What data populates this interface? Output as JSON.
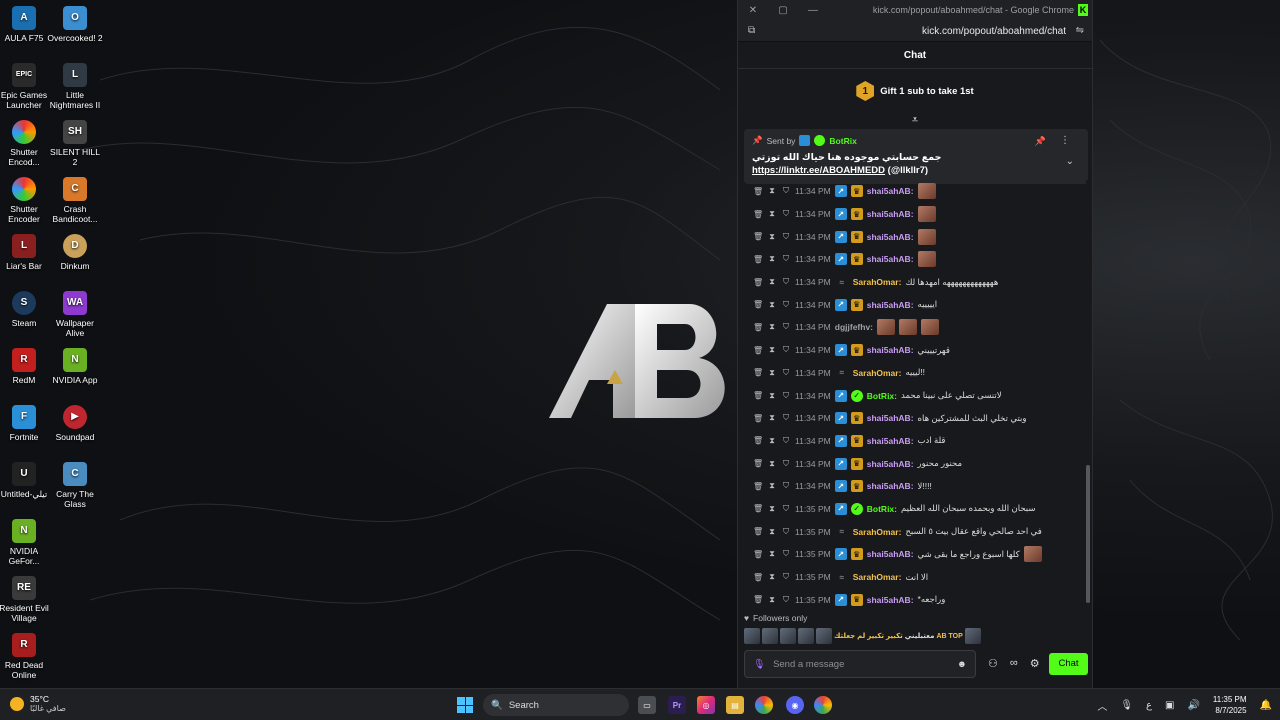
{
  "desktop": {
    "icons": [
      {
        "label": "AULA F75",
        "color": "#1a6fb0",
        "glyph": "A"
      },
      {
        "label": "Overcooked! 2",
        "color": "#3b8fd1",
        "glyph": "O"
      },
      {
        "label": "Epic Games Launcher",
        "color": "#2a2a2a",
        "glyph": "EPIC"
      },
      {
        "label": "Little Nightmares II",
        "color": "#303a44",
        "glyph": "L"
      },
      {
        "label": "Shutter Encod...",
        "color": "#d93b3b",
        "glyph": "S"
      },
      {
        "label": "SILENT HILL 2",
        "color": "#444",
        "glyph": "SH"
      },
      {
        "label": "Shutter Encoder",
        "color": "#d93b3b",
        "glyph": "S"
      },
      {
        "label": "Crash Bandicoot...",
        "color": "#d7782a",
        "glyph": "C"
      },
      {
        "label": "Liar's Bar",
        "color": "#8a1f1f",
        "glyph": "L"
      },
      {
        "label": "Dinkum",
        "color": "#c9a15a",
        "glyph": "D"
      },
      {
        "label": "Steam",
        "color": "#1b3a5c",
        "glyph": "S"
      },
      {
        "label": "Wallpaper Alive",
        "color": "#8e3ad1",
        "glyph": "WA"
      },
      {
        "label": "RedM",
        "color": "#c21f1f",
        "glyph": "R"
      },
      {
        "label": "NVIDIA App",
        "color": "#6ab023",
        "glyph": "N"
      },
      {
        "label": "Fortnite",
        "color": "#2a8fd6",
        "glyph": "F"
      },
      {
        "label": "Soundpad",
        "color": "#c0262f",
        "glyph": "▶"
      },
      {
        "label": "Untitled-تيلي",
        "color": "#222",
        "glyph": "U"
      },
      {
        "label": "Carry The Glass",
        "color": "#4a8cc0",
        "glyph": "C"
      },
      {
        "label": "NVIDIA GeFor...",
        "color": "#6ab023",
        "glyph": "N"
      },
      {
        "label": "Resident Evil Village",
        "color": "#3a3a3a",
        "glyph": "RE"
      },
      {
        "label": "Red Dead Online",
        "color": "#a81d1d",
        "glyph": "R"
      }
    ]
  },
  "window": {
    "title": "kick.com/popout/aboahmed/chat - Google Chrome",
    "url": "kick.com/popout/aboahmed/chat"
  },
  "chat": {
    "header": "Chat",
    "gift": {
      "rank": "1",
      "text": "Gift 1 sub to take 1st"
    },
    "pinned": {
      "sent_by": "Sent by",
      "bot": "BotRix",
      "message_text": "جمع حسابتي موجوده هنا حياك الله توزتي",
      "link": "https://linktr.ee/ABOAHMEDD",
      "handle": "(@llkllr7)"
    },
    "messages": [
      {
        "time": "11:34 PM",
        "user": "shai5ahAB:",
        "color": "#c99cf5",
        "badges": [
          "sub",
          "crown"
        ],
        "text": "",
        "emotes": 1
      },
      {
        "time": "11:34 PM",
        "user": "shai5ahAB:",
        "color": "#c99cf5",
        "badges": [
          "sub",
          "crown"
        ],
        "text": "",
        "emotes": 1
      },
      {
        "time": "11:34 PM",
        "user": "shai5ahAB:",
        "color": "#c99cf5",
        "badges": [
          "sub",
          "crown"
        ],
        "text": "",
        "emotes": 1
      },
      {
        "time": "11:34 PM",
        "user": "shai5ahAB:",
        "color": "#c99cf5",
        "badges": [
          "sub",
          "crown"
        ],
        "text": "",
        "emotes": 1
      },
      {
        "time": "11:34 PM",
        "user": "SarahOmar:",
        "color": "#f2c14e",
        "badges": [
          "wave"
        ],
        "text": "هههههههههههههه امهدها لك",
        "emotes": 0
      },
      {
        "time": "11:34 PM",
        "user": "shai5ahAB:",
        "color": "#c99cf5",
        "badges": [
          "sub",
          "crown"
        ],
        "text": "ايييييه",
        "emotes": 0
      },
      {
        "time": "11:34 PM",
        "user": "dgjjfefhv:",
        "color": "#a0a0a0",
        "badges": [],
        "text": "",
        "emotes": 3
      },
      {
        "time": "11:34 PM",
        "user": "shai5ahAB:",
        "color": "#c99cf5",
        "badges": [
          "sub",
          "crown"
        ],
        "text": "قهرتيييني",
        "emotes": 0
      },
      {
        "time": "11:34 PM",
        "user": "SarahOmar:",
        "color": "#f2c14e",
        "badges": [
          "wave"
        ],
        "text": "ليييه!!",
        "emotes": 0
      },
      {
        "time": "11:34 PM",
        "user": "BotRix:",
        "color": "#53fc18",
        "badges": [
          "sub",
          "verified"
        ],
        "text": "لاتنسى تصلي على نبينا محمد",
        "emotes": 0
      },
      {
        "time": "11:34 PM",
        "user": "shai5ahAB:",
        "color": "#c99cf5",
        "badges": [
          "sub",
          "crown"
        ],
        "text": "وبتي تخلي البث للمشتركين هاه",
        "emotes": 0
      },
      {
        "time": "11:34 PM",
        "user": "shai5ahAB:",
        "color": "#c99cf5",
        "badges": [
          "sub",
          "crown"
        ],
        "text": "قلة ادب",
        "emotes": 0
      },
      {
        "time": "11:34 PM",
        "user": "shai5ahAB:",
        "color": "#c99cf5",
        "badges": [
          "sub",
          "crown"
        ],
        "text": "محنور محنور",
        "emotes": 0
      },
      {
        "time": "11:34 PM",
        "user": "shai5ahAB:",
        "color": "#c99cf5",
        "badges": [
          "sub",
          "crown"
        ],
        "text": "لا!!!!",
        "emotes": 0
      },
      {
        "time": "11:35 PM",
        "user": "BotRix:",
        "color": "#53fc18",
        "badges": [
          "sub",
          "verified"
        ],
        "text": "سبحان الله وبحمده سبحان الله العظيم",
        "emotes": 0
      },
      {
        "time": "11:35 PM",
        "user": "SarahOmar:",
        "color": "#f2c14e",
        "badges": [
          "wave"
        ],
        "text": "في احد صالحي واقع عقال بيت ٥ السبح",
        "emotes": 0
      },
      {
        "time": "11:35 PM",
        "user": "shai5ahAB:",
        "color": "#c99cf5",
        "badges": [
          "sub",
          "crown"
        ],
        "text": "كلها اسبوع وراجع ما بقى شي",
        "emotes": 1
      },
      {
        "time": "11:35 PM",
        "user": "SarahOmar:",
        "color": "#f2c14e",
        "badges": [
          "wave"
        ],
        "text": "الا انت",
        "emotes": 0
      },
      {
        "time": "11:35 PM",
        "user": "shai5ahAB:",
        "color": "#c99cf5",
        "badges": [
          "sub",
          "crown"
        ],
        "text": "*وراجعه",
        "emotes": 0
      }
    ],
    "followers_only": "Followers only",
    "emote_strip_texts": [
      "لم جعلتك",
      "تكبير تكبير",
      "معتبليني",
      "AB TOP"
    ],
    "input_placeholder": "Send a message",
    "send_label": "Chat"
  },
  "taskbar": {
    "temperature": "35°C",
    "condition": "صافي غالبًا",
    "search_label": "Search",
    "time": "11:35 PM",
    "date": "8/7/2025",
    "lang": "ع"
  }
}
